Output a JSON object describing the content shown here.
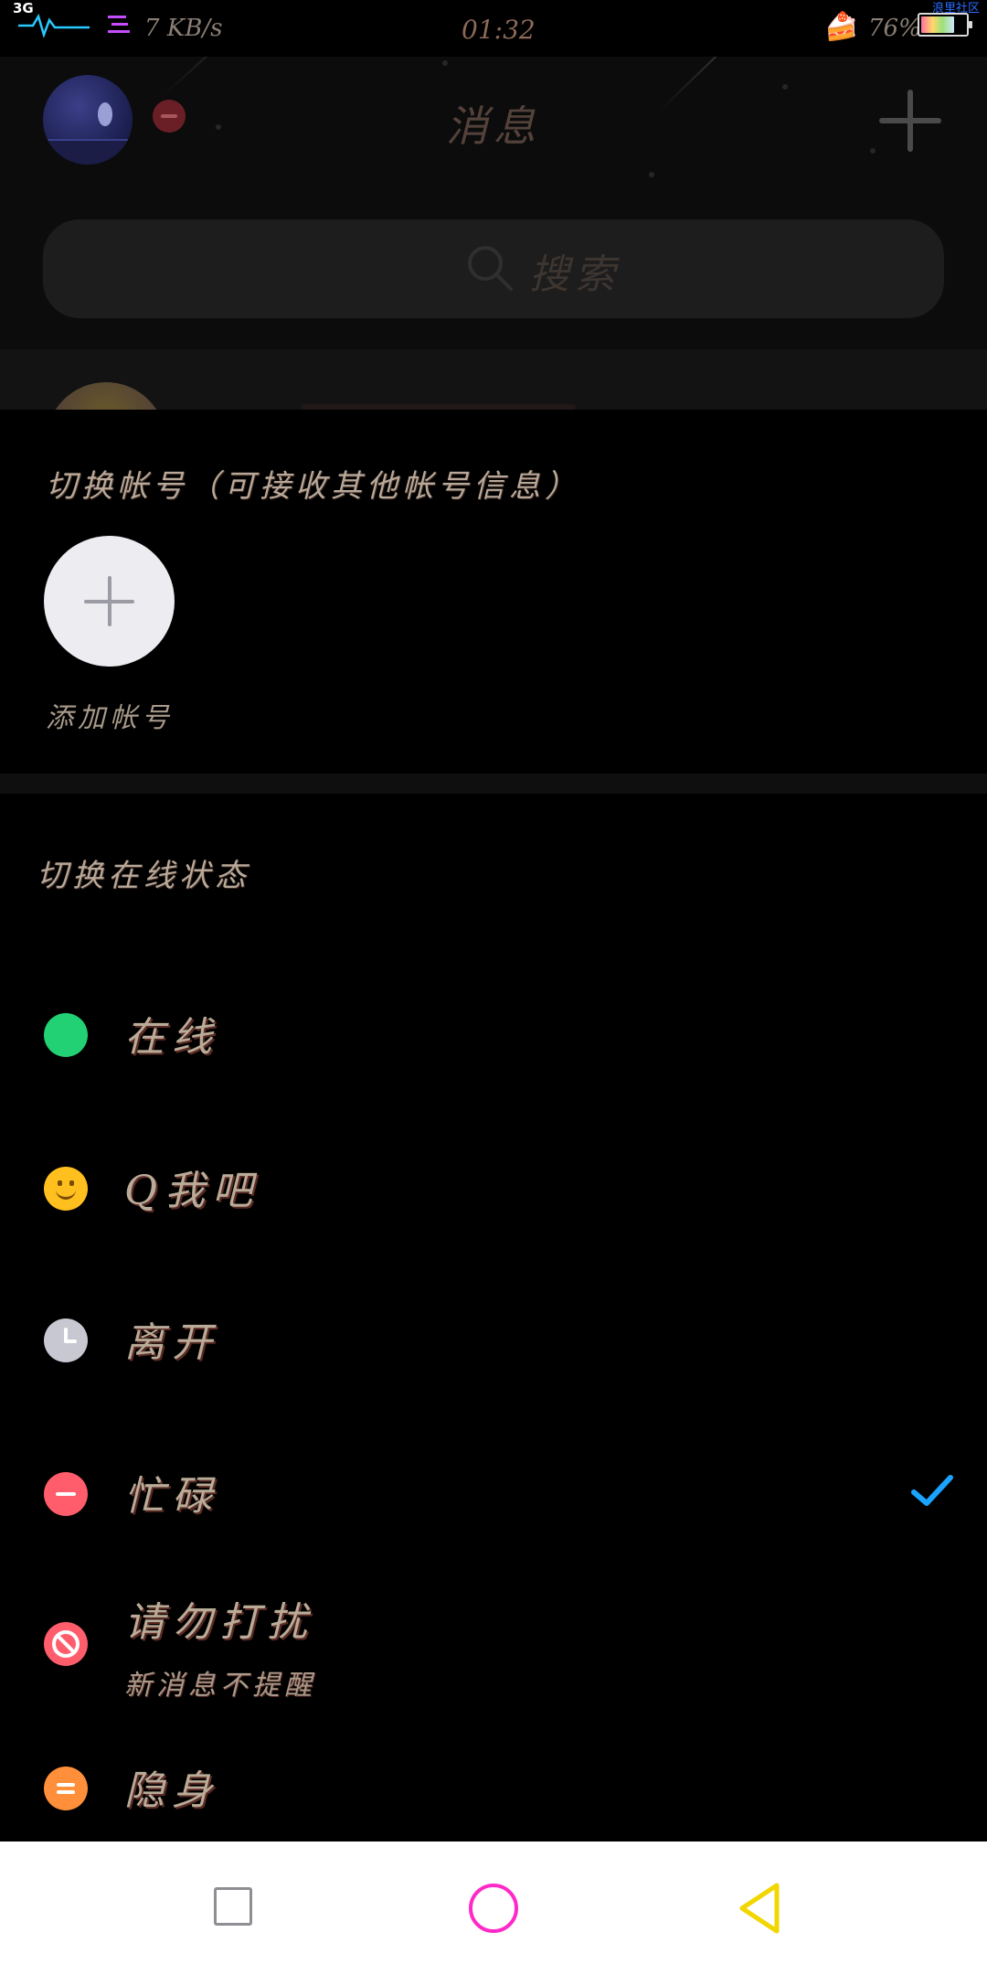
{
  "status_bar": {
    "network": "3G",
    "speed": "7 KB/s",
    "time": "01:32",
    "battery": "76%",
    "battery_level": 0.76,
    "corner_label": "浪里社区"
  },
  "header": {
    "title": "消息",
    "search_placeholder": "搜索"
  },
  "account_section": {
    "title": "切换帐号（可接收其他帐号信息）",
    "add_account_label": "添加帐号"
  },
  "status_section": {
    "title": "切换在线状态",
    "options": [
      {
        "label": "在线",
        "icon": "online-icon",
        "color": "#22d173"
      },
      {
        "label": "Q我吧",
        "icon": "smiley-icon",
        "color": "#ffbf1f"
      },
      {
        "label": "离开",
        "icon": "clock-icon",
        "color": "#c8c8d2"
      },
      {
        "label": "忙碌",
        "icon": "busy-icon",
        "color": "#ff5d6c",
        "selected": true
      },
      {
        "label": "请勿打扰",
        "sublabel": "新消息不提醒",
        "icon": "do-not-disturb-icon",
        "color": "#ff5d6c"
      },
      {
        "label": "隐身",
        "icon": "invisible-icon",
        "color": "#ff8f3a"
      }
    ]
  },
  "colors": {
    "check": "#1aa3ff",
    "nav_home": "#ff29c8",
    "nav_back": "#f2d600",
    "nav_recent": "#8e8e93"
  }
}
